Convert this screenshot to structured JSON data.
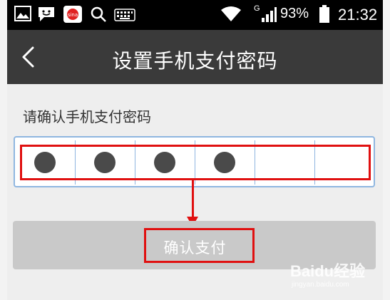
{
  "status_bar": {
    "carrier_g": "G",
    "battery_percent": "93%",
    "time": "21:32",
    "icons": [
      "gallery-icon",
      "message-icon",
      "sina-icon",
      "search-icon",
      "keyboard-icon",
      "wifi-icon",
      "signal-icon",
      "battery-icon"
    ]
  },
  "header": {
    "title": "设置手机支付密码",
    "back_icon": "back-icon"
  },
  "content": {
    "prompt": "请确认手机支付密码",
    "pin_digits_entered": 4,
    "pin_length": 6
  },
  "confirm_button": {
    "label": "确认支付"
  },
  "watermark": {
    "text": "Baidu经验",
    "sub": "jingyan.baidu.com"
  },
  "annotations": {
    "color": "#e01010"
  }
}
